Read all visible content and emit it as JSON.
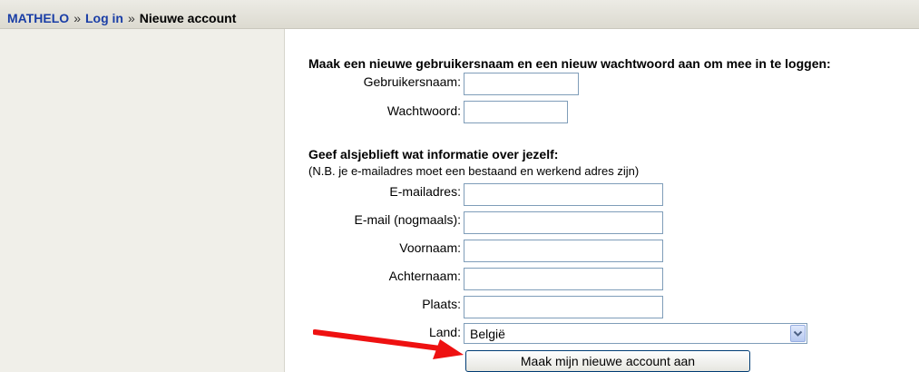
{
  "breadcrumb": {
    "items": [
      "MATHELO",
      "Log in"
    ],
    "separator": "»",
    "current": "Nieuwe account"
  },
  "form": {
    "section1_heading": "Maak een nieuwe gebruikersnaam en een nieuw wachtwoord aan om mee in te loggen:",
    "username_label": "Gebruikersnaam:",
    "username_value": "",
    "password_label": "Wachtwoord:",
    "password_value": "",
    "section2_heading": "Geef alsjeblieft wat informatie over jezelf:",
    "section2_note": "(N.B. je e-mailadres moet een bestaand en werkend adres zijn)",
    "email_label": "E-mailadres:",
    "email_value": "",
    "email2_label": "E-mail (nogmaals):",
    "email2_value": "",
    "firstname_label": "Voornaam:",
    "firstname_value": "",
    "lastname_label": "Achternaam:",
    "lastname_value": "",
    "city_label": "Plaats:",
    "city_value": "",
    "country_label": "Land:",
    "country_selected": "België",
    "submit_label": "Maak mijn nieuwe account aan"
  },
  "annotation": {
    "arrow_icon": "red-arrow-icon",
    "arrow_color": "#ee1111"
  },
  "colors": {
    "link": "#1a3ea6",
    "navbar": "#dcdad0",
    "sidebar": "#f0efe9"
  }
}
